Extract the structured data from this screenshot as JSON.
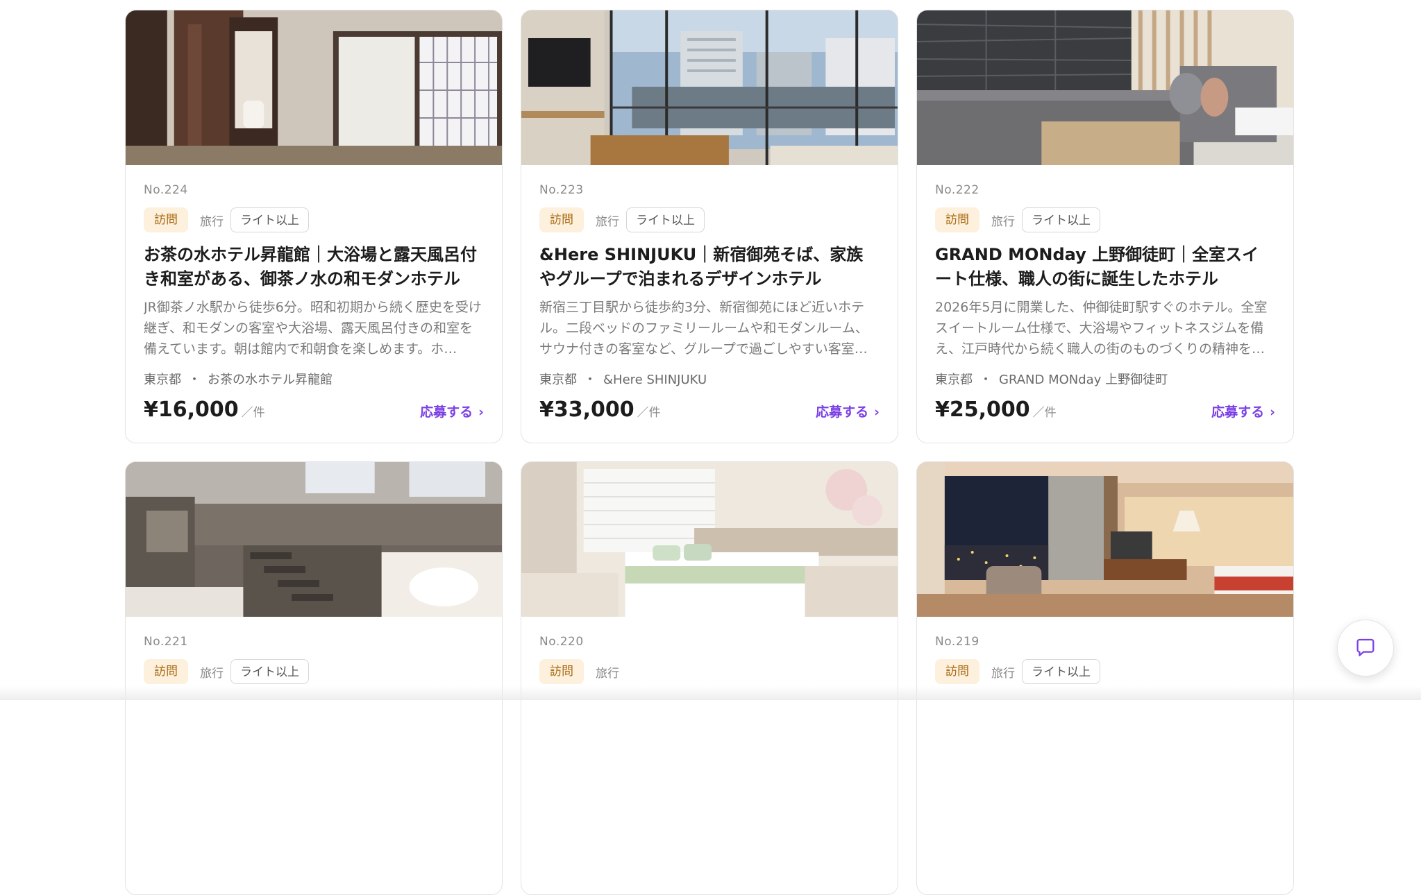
{
  "cards": [
    {
      "no": "No.224",
      "tag_visit": "訪問",
      "tag_travel": "旅行",
      "tag_plan": "ライト以上",
      "title": "お茶の水ホテル昇龍館｜大浴場と露天風呂付き和室がある、御茶ノ水の和モダンホテル",
      "desc": "JR御茶ノ水駅から徒歩6分。昭和初期から続く歴史を受け継ぎ、和モダンの客室や大浴場、露天風呂付きの和室を備えています。朝は館内で和朝食を楽しめます。ホ…",
      "pref": "東京都",
      "sep": "・",
      "hotel": "お茶の水ホテル昇龍館",
      "price": "¥16,000",
      "unit": "／件",
      "apply": "応募する",
      "chev": "›",
      "image": "japanese-room-shoji"
    },
    {
      "no": "No.223",
      "tag_visit": "訪問",
      "tag_travel": "旅行",
      "tag_plan": "ライト以上",
      "title": "&Here SHINJUKU｜新宿御苑そば、家族やグループで泊まれるデザインホテル",
      "desc": "新宿三丁目駅から徒歩約3分、新宿御苑にほど近いホテル。二段ベッドのファミリールームや和モダンルーム、サウナ付きの客室など、グループで過ごしやすい客室…",
      "pref": "東京都",
      "sep": "・",
      "hotel": "&Here SHINJUKU",
      "price": "¥33,000",
      "unit": "／件",
      "apply": "応募する",
      "chev": "›",
      "image": "city-view-room"
    },
    {
      "no": "No.222",
      "tag_visit": "訪問",
      "tag_travel": "旅行",
      "tag_plan": "ライト以上",
      "title": "GRAND MONday 上野御徒町｜全室スイート仕様、職人の街に誕生したホテル",
      "desc": "2026年5月に開業した、仲御徒町駅すぐのホテル。全室スイートルーム仕様で、大浴場やフィットネスジムを備え、江戸時代から続く職人の街のものづくりの精神を…",
      "pref": "東京都",
      "sep": "・",
      "hotel": "GRAND MONday 上野御徒町",
      "price": "¥25,000",
      "unit": "／件",
      "apply": "応募する",
      "chev": "›",
      "image": "suite-sofa"
    },
    {
      "no": "No.221",
      "tag_visit": "訪問",
      "tag_travel": "旅行",
      "tag_plan": "ライト以上",
      "title": "",
      "desc": "",
      "pref": "",
      "sep": "",
      "hotel": "",
      "price": "",
      "unit": "",
      "apply": "",
      "chev": "",
      "image": "loft-room"
    },
    {
      "no": "No.220",
      "tag_visit": "訪問",
      "tag_travel": "旅行",
      "tag_plan": "",
      "title": "",
      "desc": "",
      "pref": "",
      "sep": "",
      "hotel": "",
      "price": "",
      "unit": "",
      "apply": "",
      "chev": "",
      "image": "bright-bedroom"
    },
    {
      "no": "No.219",
      "tag_visit": "訪問",
      "tag_travel": "旅行",
      "tag_plan": "ライト以上",
      "title": "",
      "desc": "",
      "pref": "",
      "sep": "",
      "hotel": "",
      "price": "",
      "unit": "",
      "apply": "",
      "chev": "",
      "image": "night-view-room"
    }
  ],
  "chat": {
    "icon": "chat-bubble-icon"
  },
  "colors": {
    "accent": "#7b3fe4",
    "visit_tag_bg": "#fdf0dc",
    "visit_tag_text": "#a8670f"
  }
}
